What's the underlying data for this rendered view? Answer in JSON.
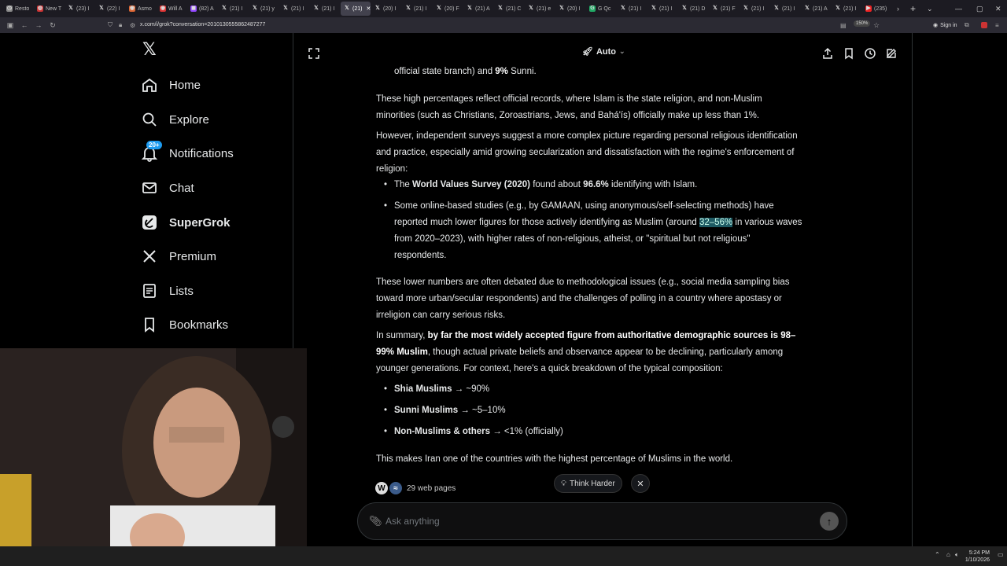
{
  "browser": {
    "tabs": [
      {
        "icon": "clock",
        "label": "Resto"
      },
      {
        "icon": "new",
        "label": "New T"
      },
      {
        "icon": "x",
        "label": "(23) I"
      },
      {
        "icon": "x",
        "label": "(22) I"
      },
      {
        "icon": "asmon",
        "label": "Asmo"
      },
      {
        "icon": "will",
        "label": "Will A"
      },
      {
        "icon": "twitch",
        "label": "(82) A"
      },
      {
        "icon": "x",
        "label": "(21) I"
      },
      {
        "icon": "x",
        "label": "(21) y"
      },
      {
        "icon": "x",
        "label": "(21) I"
      },
      {
        "icon": "x",
        "label": "(21) I"
      },
      {
        "icon": "x",
        "label": "(21)",
        "active": true
      },
      {
        "icon": "x",
        "label": "(20) I"
      },
      {
        "icon": "x",
        "label": "(21) I"
      },
      {
        "icon": "x",
        "label": "(20) F"
      },
      {
        "icon": "x",
        "label": "(21) A"
      },
      {
        "icon": "x",
        "label": "(21) C"
      },
      {
        "icon": "x",
        "label": "(21) e"
      },
      {
        "icon": "x",
        "label": "(20) I"
      },
      {
        "icon": "g",
        "label": "G Qc"
      },
      {
        "icon": "x",
        "label": "(21) I"
      },
      {
        "icon": "x",
        "label": "(21) I"
      },
      {
        "icon": "x",
        "label": "(21) D"
      },
      {
        "icon": "x",
        "label": "(21) F"
      },
      {
        "icon": "x",
        "label": "(21) I"
      },
      {
        "icon": "x",
        "label": "(21) I"
      },
      {
        "icon": "x",
        "label": "(21) A"
      },
      {
        "icon": "x",
        "label": "(21) I"
      },
      {
        "icon": "yt",
        "label": "(235)"
      }
    ],
    "url": "x.com/i/grok?conversation=2010130555862487277",
    "zoom": "150%",
    "sign_in": "Sign in"
  },
  "sidebar": {
    "items": [
      {
        "label": "Home",
        "icon": "home-icon"
      },
      {
        "label": "Explore",
        "icon": "search-icon"
      },
      {
        "label": "Notifications",
        "icon": "bell-icon",
        "badge": "20+"
      },
      {
        "label": "Chat",
        "icon": "mail-icon"
      },
      {
        "label": "SuperGrok",
        "icon": "grok-icon"
      },
      {
        "label": "Premium",
        "icon": "x-icon"
      },
      {
        "label": "Lists",
        "icon": "list-icon"
      },
      {
        "label": "Bookmarks",
        "icon": "bookmark-icon"
      }
    ]
  },
  "topbar": {
    "mode": "Auto"
  },
  "content": {
    "p0_a": "official state branch) and ",
    "p0_b": "9%",
    "p0_c": " Sunni.",
    "p1_l1": "These high percentages reflect official records, where Islam is the state religion, and non-Muslim",
    "p1_l2": "minorities (such as Christians, Zoroastrians, Jews, and Bahá'ís) officially make up less than 1%.",
    "p2_l1": "However, independent surveys suggest a more complex picture regarding personal religious identification",
    "p2_l2": "and practice, especially amid growing secularization and dissatisfaction with the regime's enforcement of",
    "p2_l3": "religion:",
    "b1_a": "The ",
    "b1_b": "World Values Survey (2020)",
    "b1_c": " found about ",
    "b1_d": "96.6%",
    "b1_e": " identifying with Islam.",
    "b2_l1": "Some online-based studies (e.g., by GAMAAN, using anonymous/self-selecting methods) have",
    "b2_l2a": "reported much lower figures for those actively identifying as Muslim (around ",
    "b2_l2b": "32–56%",
    "b2_l2c": " in various waves",
    "b2_l3": "from 2020–2023), with higher rates of non-religious, atheist, or \"spiritual but not religious\"",
    "b2_l4": "respondents.",
    "p3_l1": "These lower numbers are often debated due to methodological issues (e.g., social media sampling bias",
    "p3_l2": "toward more urban/secular respondents) and the challenges of polling in a country where apostasy or",
    "p3_l3": "irreligion can carry serious risks.",
    "p4_l1a": "In summary, ",
    "p4_l1b": "by far the most widely accepted figure from authoritative demographic sources is 98–",
    "p4_l2a": "99% Muslim",
    "p4_l2b": ", though actual private beliefs and observance appear to be declining, particularly among",
    "p4_l3": "younger generations. For context, here's a quick breakdown of the typical composition:",
    "c1_a": "Shia Muslims",
    "c1_b": " → ~90%",
    "c2_a": "Sunni Muslims",
    "c2_b": " → ~5–10%",
    "c3_a": "Non-Muslims & others",
    "c3_b": " → <1% (officially)",
    "p5": "This makes Iran one of the countries with the highest percentage of Muslims in the world."
  },
  "footer": {
    "sources": "29 web pages",
    "think_harder": "Think Harder",
    "ask_placeholder": "Ask anything"
  },
  "taskbar": {
    "time": "5:24 PM",
    "date": "1/10/2026"
  }
}
